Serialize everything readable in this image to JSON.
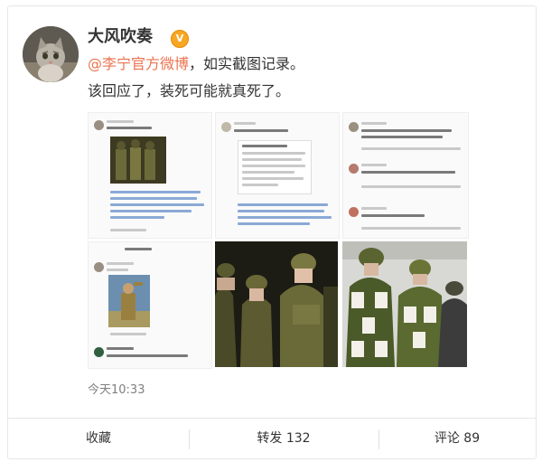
{
  "post": {
    "username": "大风吹奏",
    "verified_badge": "V",
    "mention": "@李宁官方微博",
    "text_after_mention": "，如实截图记录。",
    "text_line2": "该回应了，装死可能就真死了。",
    "time": "今天10:33"
  },
  "footer": {
    "favorite_label": "收藏",
    "repost_label": "转发 132",
    "comment_label": "评论 89"
  },
  "images": [
    {
      "name": "screenshot-comment-thread",
      "description_icon": "chat-screenshot"
    },
    {
      "name": "screenshot-article",
      "description_icon": "article-screenshot"
    },
    {
      "name": "screenshot-comments-list",
      "description_icon": "comments-screenshot"
    },
    {
      "name": "screenshot-reply",
      "description_icon": "reply-screenshot"
    },
    {
      "name": "photo-runway-models",
      "description_icon": "photo"
    },
    {
      "name": "photo-runway-jackets",
      "description_icon": "photo"
    }
  ]
}
